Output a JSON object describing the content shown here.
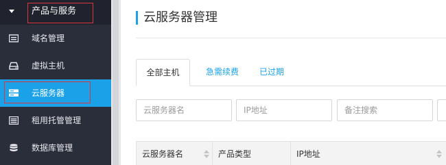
{
  "sidebar": {
    "header": {
      "title": "产品与服务"
    },
    "items": [
      {
        "label": "域名管理",
        "icon": "domain-icon"
      },
      {
        "label": "虚拟主机",
        "icon": "virtual-host-icon"
      },
      {
        "label": "云服务器",
        "icon": "cloud-server-icon",
        "active": true
      },
      {
        "label": "租用托管管理",
        "icon": "hosting-icon"
      },
      {
        "label": "数据库管理",
        "icon": "database-icon"
      }
    ]
  },
  "main": {
    "title": "云服务器管理",
    "tabs": [
      {
        "label": "全部主机",
        "active": true
      },
      {
        "label": "急需续费"
      },
      {
        "label": "已过期"
      }
    ],
    "filters": {
      "name_placeholder": "云服务器名",
      "ip_placeholder": "IP地址",
      "remark_placeholder": "备注搜索"
    },
    "table": {
      "columns": [
        "云服务器名",
        "产品类型",
        "IP地址"
      ]
    }
  },
  "colors": {
    "accent": "#1aa1e8",
    "sidebar_bg": "#2a2d3a",
    "highlight_box": "#d9363e"
  }
}
